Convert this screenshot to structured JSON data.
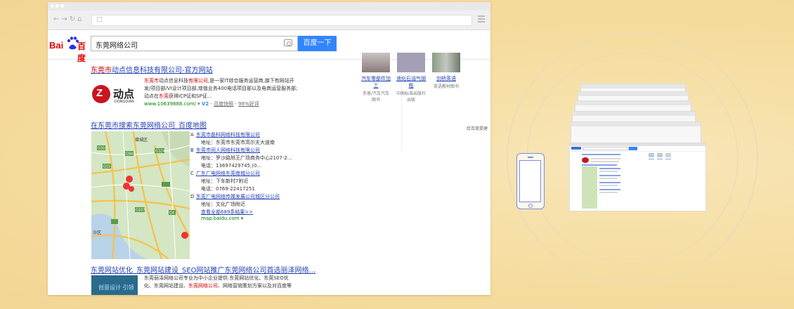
{
  "search": {
    "query": "东莞网络公司",
    "button_label": "百度一下"
  },
  "logo": {
    "bai": "Bai",
    "du": "百度"
  },
  "results": [
    {
      "title_red": "东莞市",
      "title_rest": "动点信息科技有限公司-官方网站",
      "logo_char": "Z",
      "logo_text": "动点",
      "logo_en": "DONGDIAN",
      "lines": [
        [
          "东莞市",
          "动点信息科技",
          "有限公司",
          ",是一家IT综合服务运营商,旗下有网站开"
        ],
        [
          "发/项目部/VI设计项目部,增值业务400电话项目部以及电商运营服务部;"
        ],
        [
          "动点在",
          "东莞",
          "获得ICP证和SP证..."
        ]
      ],
      "url": "www.10639888.com/",
      "v2": "V2",
      "snapshot": "百度快照",
      "rating": "98%好评"
    },
    {
      "title": "在东莞市搜索东莞网络公司_百度地图",
      "places": [
        {
          "letter": "A",
          "name": "东莞市磊科网络科技有限公司",
          "addr": "地址：东莞市东莞市高尔夫大道南"
        },
        {
          "letter": "B",
          "name": "东莞市同人网络科技有限公司",
          "addr": "地址：罗沙路旭王广场商务中心2107-2...",
          "phone": "电话：13697429745,(0..."
        },
        {
          "letter": "C",
          "name": "广东广电网络东莞南城分公司",
          "addr": "地址：下车新村7附近",
          "phone": "电话：0769-22417251"
        },
        {
          "letter": "D",
          "name": "东莞广电网络传媒发展公司城区分公司",
          "addr": "地址：文化广场附近"
        }
      ],
      "more": "查看全部689条结果>>",
      "source": "map.baidu.com"
    },
    {
      "title": "东莞网站优化_东莞网站建设_SEO网站推广东莞网络公司首选丽泽网络...",
      "img_text": "创意设计 引领",
      "lines": [
        [
          "东莞丽泽网络公司专业为中小企业提供:东莞网站优化、东莞SEO优"
        ],
        [
          "化、东莞网站建设、",
          "东莞网络公司",
          "、网络营销策划方案以及对百度等"
        ]
      ]
    }
  ],
  "sidebar": {
    "cards": [
      {
        "title": "汽车零部件加工",
        "sub": "手册/汽车汽车图书"
      },
      {
        "title": "液化石油气钢瓶",
        "sub": "中国标准出版社出版"
      },
      {
        "title": "剑桥英语",
        "sub": "英语教材图书"
      }
    ],
    "footer_link": "给百度提建"
  },
  "map_labels": [
    "增城区",
    "G35",
    "G324",
    "G94",
    "G15",
    "G107",
    "G4",
    "沙区"
  ],
  "colors": {
    "background": "#f5dc9e",
    "link": "#2440b3",
    "highlight": "#c00000",
    "search_button": "#3385ff",
    "ring": "#e9d9b0",
    "phone_outline": "#7b8de0"
  }
}
